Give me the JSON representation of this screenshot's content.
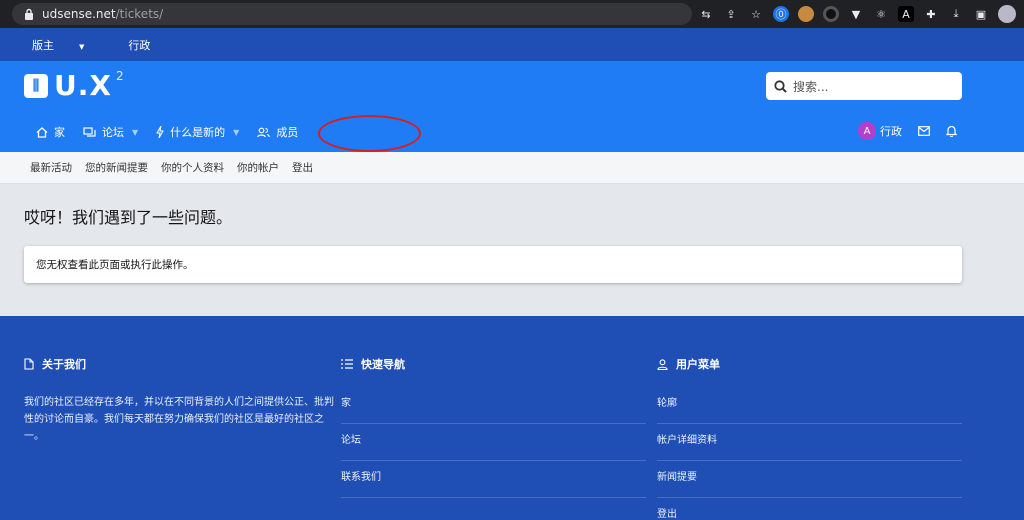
{
  "browser": {
    "url_host": "udsense.net",
    "url_path": "/tickets/"
  },
  "staff_bar": {
    "moderator_label": "版主",
    "admin_label": "行政"
  },
  "logo": {
    "text": "U.X",
    "superscript": "2"
  },
  "search": {
    "placeholder": "搜索..."
  },
  "nav": {
    "items": [
      {
        "label": "家",
        "icon": "home-icon"
      },
      {
        "label": "论坛",
        "icon": "forum-icon"
      },
      {
        "label": "什么是新的",
        "icon": "bolt-icon"
      },
      {
        "label": "成员",
        "icon": "members-icon"
      }
    ],
    "user": {
      "avatar_letter": "A",
      "name": "行政"
    }
  },
  "subnav": {
    "items": [
      "最新活动",
      "您的新闻提要",
      "你的个人资料",
      "你的帐户",
      "登出"
    ]
  },
  "main": {
    "title": "哎呀！我们遇到了一些问题。",
    "notice": "您无权查看此页面或执行此操作。"
  },
  "footer": {
    "about": {
      "title": "关于我们",
      "text": "我们的社区已经存在多年，并以在不同背景的人们之间提供公正、批判性的讨论而自豪。我们每天都在努力确保我们的社区是最好的社区之一。"
    },
    "quick_nav": {
      "title": "快速导航",
      "links": [
        "家",
        "论坛",
        "联系我们"
      ]
    },
    "user_menu": {
      "title": "用户菜单",
      "links": [
        "轮廓",
        "帐户详细资料",
        "新闻提要",
        "登出"
      ]
    }
  },
  "colors": {
    "header": "#1f7cf5",
    "staff_bar": "#1f4fb5",
    "footer": "#1f4fb5",
    "annotation": "#d42020"
  }
}
